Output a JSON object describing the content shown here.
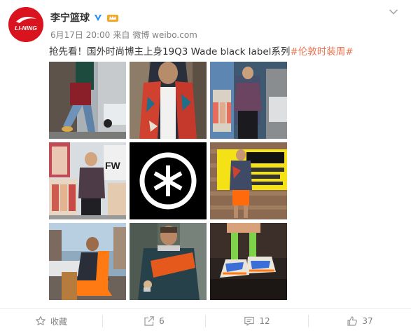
{
  "post": {
    "username": "李宁篮球",
    "date": "6月17日 20:00",
    "from_label": "来自",
    "source": "微博 weibo.com",
    "text_prefix": "抢先看！国外时尚博主上身19Q3 Wade black label系列",
    "hashtag": "#伦敦时装周#",
    "avatar_logo_text": "LI-NING"
  },
  "actions": {
    "favorite": "收藏",
    "repost": "6",
    "comment": "12",
    "like": "37"
  },
  "icons": {
    "verified": "verified-v-icon",
    "vip": "vip-crown-icon",
    "menu": "chevron-down-icon",
    "favorite": "star-icon",
    "repost": "share-icon",
    "comment": "comment-icon",
    "like": "thumbs-up-icon"
  },
  "colors": {
    "brand_red": "#d9141e",
    "hashtag": "#eb7350",
    "verified_blue": "#1a8cff",
    "vip_orange": "#f5a623"
  }
}
